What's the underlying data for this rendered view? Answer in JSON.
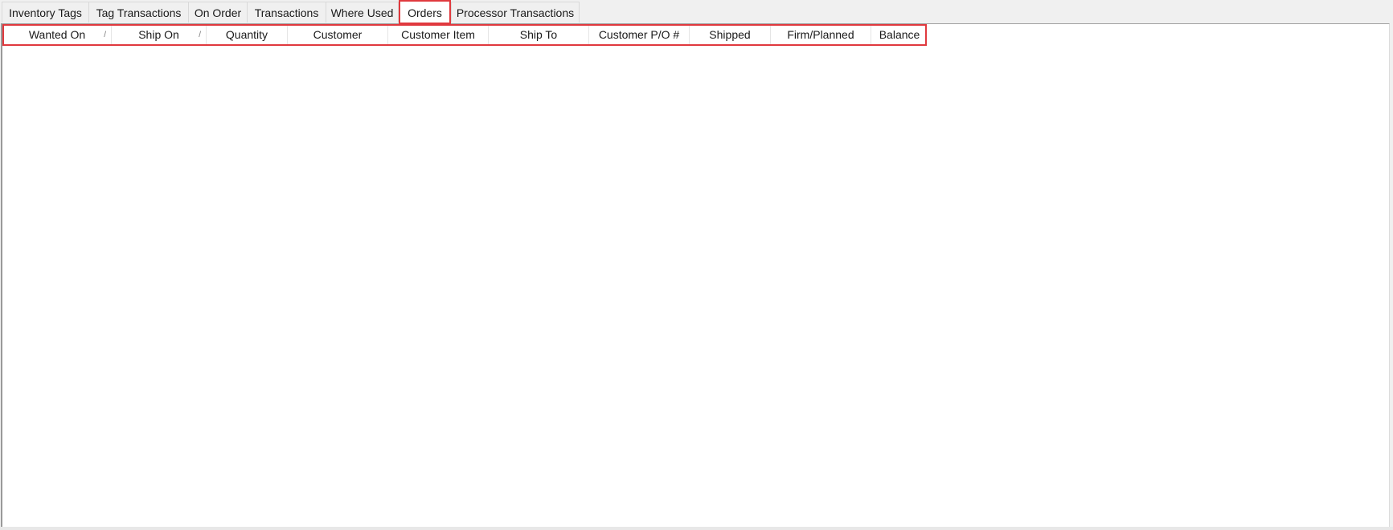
{
  "tabs": [
    {
      "label": "Inventory Tags",
      "active": false
    },
    {
      "label": "Tag Transactions",
      "active": false
    },
    {
      "label": "On Order",
      "active": false
    },
    {
      "label": "Transactions",
      "active": false
    },
    {
      "label": "Where Used",
      "active": false
    },
    {
      "label": "Orders",
      "active": true
    },
    {
      "label": "Processor Transactions",
      "active": false
    }
  ],
  "grid": {
    "columns": [
      {
        "label": "Wanted On",
        "sort_indicator": "/"
      },
      {
        "label": "Ship On",
        "sort_indicator": "/"
      },
      {
        "label": "Quantity"
      },
      {
        "label": "Customer"
      },
      {
        "label": "Customer Item"
      },
      {
        "label": "Ship To"
      },
      {
        "label": "Customer P/O #"
      },
      {
        "label": "Shipped"
      },
      {
        "label": "Firm/Planned"
      },
      {
        "label": "Balance"
      }
    ],
    "rows": []
  },
  "highlight_color": "#e0393e"
}
